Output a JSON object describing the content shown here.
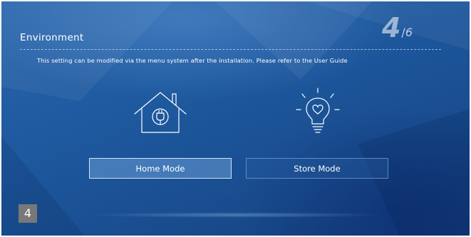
{
  "header": {
    "title": "Environment",
    "step_current": "4",
    "step_separator": "/",
    "step_total": "6"
  },
  "description": "This setting can be modified via the menu system after the installation. Please refer to the User Guide",
  "options": {
    "home": {
      "label": "Home Mode",
      "icon": "house-plug-icon",
      "selected": true
    },
    "store": {
      "label": "Store Mode",
      "icon": "light-bulb-icon",
      "selected": false
    }
  },
  "overlay_badge": "4",
  "colors": {
    "background": "#1f5aa0",
    "selected_button": "#6f9fd4",
    "badge": "#787878"
  }
}
